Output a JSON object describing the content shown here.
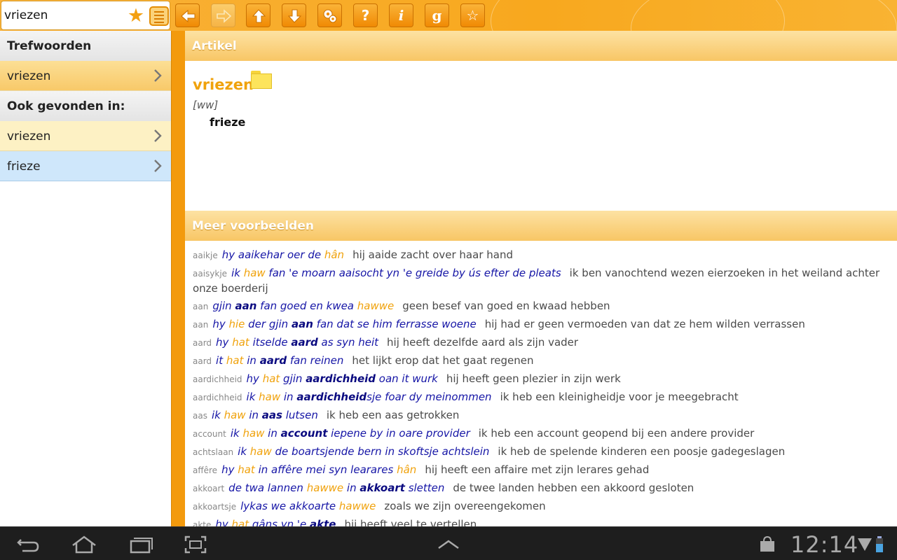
{
  "search": {
    "value": "vriezen"
  },
  "colors": {
    "accent": "#f8a81e",
    "headword": "#f0a20c",
    "frisian": "#1515a6",
    "navbar": "#1e1e1e"
  },
  "toolbar": {
    "buttons": [
      {
        "name": "back-button",
        "icon": "arrow-left-icon",
        "enabled": true
      },
      {
        "name": "forward-button",
        "icon": "arrow-right-icon",
        "enabled": false
      },
      {
        "name": "up-button",
        "icon": "arrow-up-icon",
        "enabled": true
      },
      {
        "name": "down-button",
        "icon": "arrow-down-icon",
        "enabled": true
      },
      {
        "name": "settings-button",
        "icon": "gears-icon",
        "enabled": true
      },
      {
        "name": "help-button",
        "icon": "question-icon",
        "enabled": true,
        "glyph": "?"
      },
      {
        "name": "info-button",
        "icon": "info-icon",
        "enabled": true,
        "glyph": "i"
      },
      {
        "name": "google-button",
        "icon": "google-icon",
        "enabled": true,
        "glyph": "g"
      },
      {
        "name": "favorites-button",
        "icon": "star-outline-icon",
        "enabled": true
      }
    ]
  },
  "sidebar": {
    "trefwoorden_label": "Trefwoorden",
    "ook_label": "Ook gevonden in:",
    "items": [
      {
        "label": "vriezen",
        "state": "selected"
      },
      {
        "label": "vriezen",
        "state": "normal"
      },
      {
        "label": "frieze",
        "state": "highlight"
      }
    ]
  },
  "article": {
    "section_title": "Artikel",
    "headword": "vriezen",
    "pos": "[ww]",
    "translation": "frieze"
  },
  "examples": {
    "section_title": "Meer voorbeelden",
    "rows": [
      {
        "kw": "aaikje",
        "parts": [
          [
            "hy ",
            ""
          ],
          [
            "aaike",
            " "
          ],
          [
            "har oer de ",
            ""
          ],
          [
            "hân",
            "o"
          ]
        ],
        "nl": "hij aaide zacht over haar hand"
      },
      {
        "kw": "aaisykje",
        "parts": [
          [
            "ik ",
            ""
          ],
          [
            "haw",
            "o"
          ],
          [
            " fan 'e moarn aaisocht yn 'e greide by ús efter de pleats",
            ""
          ]
        ],
        "nl": "ik ben vanochtend wezen eierzoeken in het weiland achter onze boerderij"
      },
      {
        "kw": "aan",
        "parts": [
          [
            "gjin ",
            ""
          ],
          [
            "aan",
            "b"
          ],
          [
            " fan goed en kwea ",
            ""
          ],
          [
            "hawwe",
            "o"
          ]
        ],
        "nl": "geen besef van goed en kwaad hebben"
      },
      {
        "kw": "aan",
        "parts": [
          [
            "hy ",
            ""
          ],
          [
            "hie",
            "o"
          ],
          [
            " der gjin ",
            ""
          ],
          [
            "aan",
            "b"
          ],
          [
            " fan dat se him ferrasse woene",
            ""
          ]
        ],
        "nl": "hij had er geen vermoeden van dat ze hem wilden verrassen"
      },
      {
        "kw": "aard",
        "parts": [
          [
            "hy ",
            ""
          ],
          [
            "hat",
            "o"
          ],
          [
            " itselde ",
            ""
          ],
          [
            "aard",
            "b"
          ],
          [
            " as syn heit",
            ""
          ]
        ],
        "nl": "hij heeft dezelfde aard als zijn vader"
      },
      {
        "kw": "aard",
        "parts": [
          [
            "it ",
            ""
          ],
          [
            "hat",
            "o"
          ],
          [
            " in ",
            ""
          ],
          [
            "aard",
            "b"
          ],
          [
            " fan reinen",
            ""
          ]
        ],
        "nl": "het lijkt erop dat het gaat regenen"
      },
      {
        "kw": "aardichheid",
        "parts": [
          [
            "hy ",
            ""
          ],
          [
            "hat",
            "o"
          ],
          [
            " gjin ",
            ""
          ],
          [
            "aardichheid",
            "b"
          ],
          [
            " oan it wurk",
            ""
          ]
        ],
        "nl": "hij heeft geen plezier in zijn werk"
      },
      {
        "kw": "aardichheid",
        "parts": [
          [
            "ik ",
            ""
          ],
          [
            "haw",
            "o"
          ],
          [
            " in ",
            ""
          ],
          [
            "aardichheid",
            "b"
          ],
          [
            "sje foar dy meinommen",
            ""
          ]
        ],
        "nl": "ik heb een kleinigheidje voor je meegebracht"
      },
      {
        "kw": "aas",
        "parts": [
          [
            "ik ",
            ""
          ],
          [
            "haw",
            "o"
          ],
          [
            " in ",
            ""
          ],
          [
            "aas",
            "b"
          ],
          [
            " lutsen",
            ""
          ]
        ],
        "nl": "ik heb een aas getrokken"
      },
      {
        "kw": "account",
        "parts": [
          [
            "ik ",
            ""
          ],
          [
            "haw",
            "o"
          ],
          [
            " in ",
            ""
          ],
          [
            "account",
            "b"
          ],
          [
            " iepene by in oare provider",
            ""
          ]
        ],
        "nl": "ik heb een account geopend bij een andere provider"
      },
      {
        "kw": "achtslaan",
        "parts": [
          [
            "ik ",
            ""
          ],
          [
            "haw",
            "o"
          ],
          [
            " de boartsjende bern in skoftsje achtslein",
            ""
          ]
        ],
        "nl": "ik heb de spelende kinderen een poosje gadegeslagen"
      },
      {
        "kw": "affêre",
        "parts": [
          [
            "hy ",
            ""
          ],
          [
            "hat",
            "o"
          ],
          [
            " in affêre mei syn learares ",
            ""
          ],
          [
            "hân",
            "o"
          ]
        ],
        "nl": "hij heeft een affaire met zijn lerares gehad"
      },
      {
        "kw": "akkoart",
        "parts": [
          [
            "de twa lannen ",
            ""
          ],
          [
            "hawwe",
            "o"
          ],
          [
            " in ",
            ""
          ],
          [
            "akkoart",
            "b"
          ],
          [
            " sletten",
            ""
          ]
        ],
        "nl": "de twee landen hebben een akkoord gesloten"
      },
      {
        "kw": "akkoartsje",
        "parts": [
          [
            "lykas we akkoarte ",
            ""
          ],
          [
            "hawwe",
            "o"
          ]
        ],
        "nl": "zoals we zijn overeengekomen"
      },
      {
        "kw": "akte",
        "parts": [
          [
            "hy ",
            ""
          ],
          [
            "hat",
            "o"
          ],
          [
            " gâns yn 'e ",
            ""
          ],
          [
            "akte",
            "b"
          ]
        ],
        "nl": "hij heeft veel te vertellen"
      }
    ]
  },
  "statusbar": {
    "time": "12:14"
  }
}
